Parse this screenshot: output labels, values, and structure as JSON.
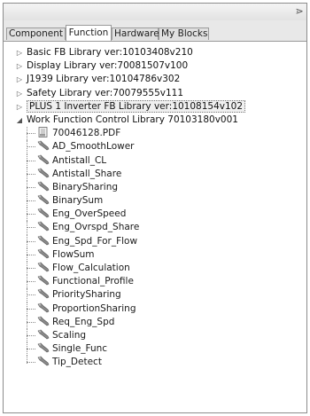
{
  "tabs": [
    {
      "label": "Component",
      "active": false
    },
    {
      "label": "Function",
      "active": true
    },
    {
      "label": "Hardware",
      "active": false
    },
    {
      "label": "My Blocks",
      "active": false
    }
  ],
  "tree": {
    "roots": [
      {
        "label": "Basic FB Library ver:10103408v210",
        "expanded": false
      },
      {
        "label": "Display Library ver:70081507v100",
        "expanded": false
      },
      {
        "label": "J1939 Library ver:10104786v302",
        "expanded": false
      },
      {
        "label": "Safety Library ver:70079555v111",
        "expanded": false
      },
      {
        "label": "PLUS 1 Inverter FB Library ver:10108154v102",
        "expanded": false,
        "selected": true
      },
      {
        "label": "Work Function Control Library 70103180v001",
        "expanded": true
      }
    ],
    "children": [
      {
        "label": "70046128.PDF",
        "icon": "pdf-document-icon"
      },
      {
        "label": "AD_SmoothLower",
        "icon": "function-block-icon"
      },
      {
        "label": "Antistall_CL",
        "icon": "function-block-icon"
      },
      {
        "label": "Antistall_Share",
        "icon": "function-block-icon"
      },
      {
        "label": "BinarySharing",
        "icon": "function-block-icon"
      },
      {
        "label": "BinarySum",
        "icon": "function-block-icon"
      },
      {
        "label": "Eng_OverSpeed",
        "icon": "function-block-icon"
      },
      {
        "label": "Eng_Ovrspd_Share",
        "icon": "function-block-icon"
      },
      {
        "label": "Eng_Spd_For_Flow",
        "icon": "function-block-icon"
      },
      {
        "label": "FlowSum",
        "icon": "function-block-icon"
      },
      {
        "label": "Flow_Calculation",
        "icon": "function-block-icon"
      },
      {
        "label": "Functional_Profile",
        "icon": "function-block-icon"
      },
      {
        "label": "PrioritySharing",
        "icon": "function-block-icon"
      },
      {
        "label": "ProportionSharing",
        "icon": "function-block-icon"
      },
      {
        "label": "Req_Eng_Spd",
        "icon": "function-block-icon"
      },
      {
        "label": "Scaling",
        "icon": "function-block-icon"
      },
      {
        "label": "Single_Func",
        "icon": "function-block-icon"
      },
      {
        "label": "Tip_Detect",
        "icon": "function-block-icon"
      }
    ]
  },
  "icons": {
    "collapsed": "▷",
    "expanded": "◢",
    "panel_menu": "⋗"
  }
}
